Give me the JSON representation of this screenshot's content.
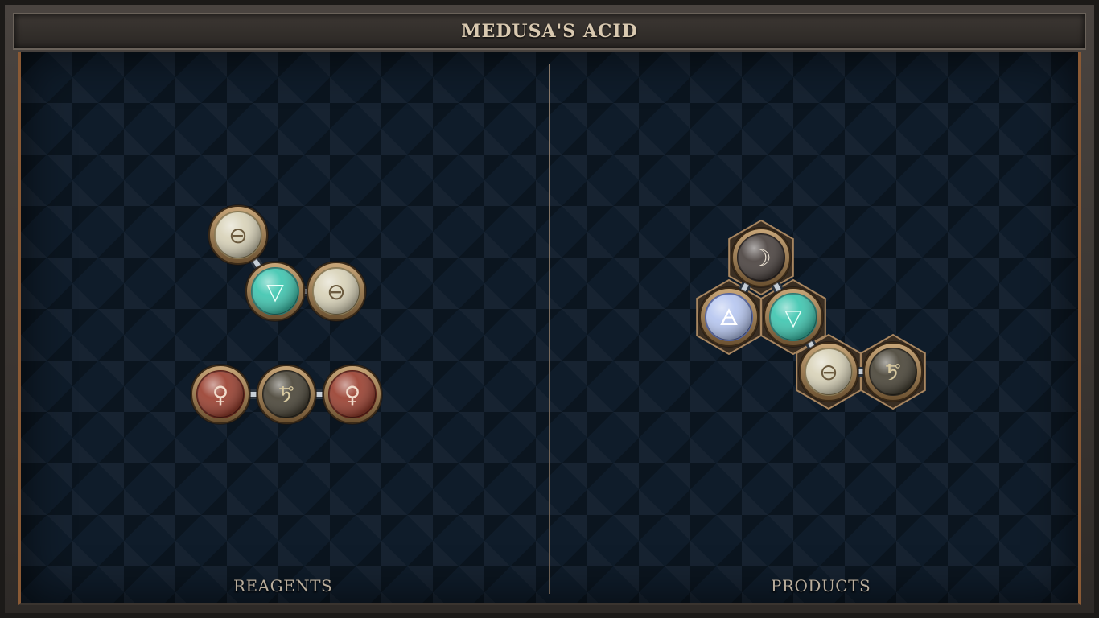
{
  "title": "MEDUSA'S ACID",
  "panels": {
    "reagents_label": "REAGENTS",
    "products_label": "PRODUCTS"
  },
  "atom_styles": {
    "salt": {
      "symbol": "⊖",
      "fill": "#d8d2b8",
      "rim": "#8a7a55",
      "glyph": "#6b5a3e"
    },
    "water": {
      "symbol": "▽",
      "fill": "#3fc6b0",
      "rim": "#2a7a72",
      "glyph": "#e9fff8"
    },
    "copper": {
      "symbol": "♀",
      "fill": "#9a4030",
      "rim": "#5a2018",
      "glyph": "#f2dccc"
    },
    "lead": {
      "symbol": "🜪",
      "fill": "#4a4538",
      "rim": "#2a261e",
      "glyph": "#d8c9a0"
    },
    "silver": {
      "symbol": "☽",
      "fill": "#4b4340",
      "rim": "#2a2422",
      "glyph": "#efe6d6"
    },
    "air": {
      "symbol": "🜁",
      "fill": "#b6c6f0",
      "rim": "#5565a0",
      "glyph": "#ffffff"
    }
  },
  "reagents": [
    {
      "atoms": [
        {
          "element": "salt"
        },
        {
          "element": "water"
        },
        {
          "element": "salt"
        }
      ],
      "bonds": [
        [
          0,
          1
        ],
        [
          1,
          2
        ]
      ]
    },
    {
      "atoms": [
        {
          "element": "copper"
        },
        {
          "element": "lead"
        },
        {
          "element": "copper"
        }
      ],
      "bonds": [
        [
          0,
          1
        ],
        [
          1,
          2
        ]
      ]
    }
  ],
  "products": [
    {
      "atoms": [
        {
          "element": "silver"
        },
        {
          "element": "air"
        },
        {
          "element": "water"
        },
        {
          "element": "salt"
        },
        {
          "element": "lead"
        }
      ],
      "bonds": [
        [
          0,
          1
        ],
        [
          0,
          2
        ],
        [
          2,
          3
        ],
        [
          3,
          4
        ]
      ]
    }
  ]
}
